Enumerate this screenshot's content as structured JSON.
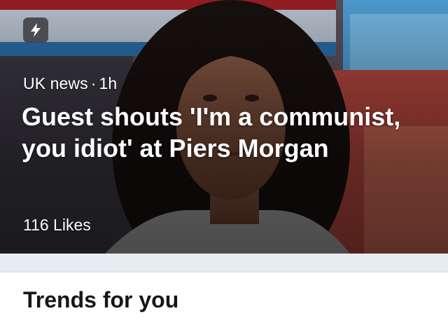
{
  "moment_card": {
    "badge_icon": "lightning-bolt-icon",
    "category": "UK news",
    "separator": "·",
    "age": "1h",
    "headline": "Guest shouts 'I'm a communist, you idiot' at Piers Morgan",
    "likes": "116 Likes"
  },
  "section": {
    "title": "Trends for you"
  }
}
